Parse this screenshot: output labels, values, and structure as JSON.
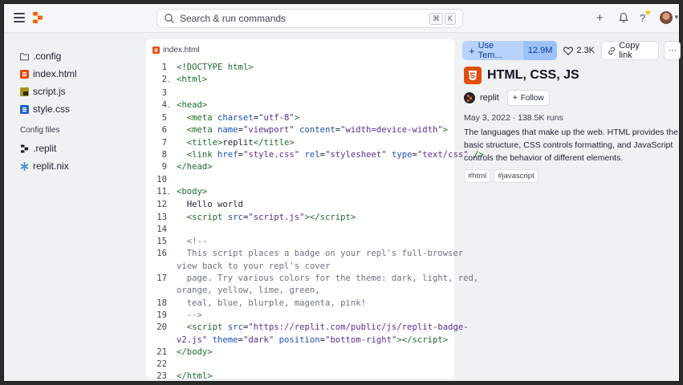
{
  "search": {
    "placeholder": "Search & run commands",
    "shortcut": [
      "⌘",
      "K"
    ]
  },
  "topbar": {
    "add_icon": "plus-icon",
    "notifications_icon": "bell-icon",
    "help_icon": "question-icon"
  },
  "sidebar": {
    "files": [
      {
        "name": ".config",
        "icon": "folder-icon"
      },
      {
        "name": "index.html",
        "icon": "html-file-icon"
      },
      {
        "name": "script.js",
        "icon": "js-file-icon"
      },
      {
        "name": "style.css",
        "icon": "css-file-icon"
      }
    ],
    "config_section_label": "Config files",
    "config_files": [
      {
        "name": ".replit",
        "icon": "replit-icon"
      },
      {
        "name": "replit.nix",
        "icon": "nix-icon"
      }
    ]
  },
  "editor": {
    "tab_name": "index.html",
    "lines": [
      {
        "n": "1",
        "fold": "",
        "html": "<span class=\"tag\">&lt;!DOCTYPE html&gt;</span>"
      },
      {
        "n": "2",
        "fold": "v",
        "html": "<span class=\"tag\">&lt;html&gt;</span>"
      },
      {
        "n": "3",
        "fold": "",
        "html": ""
      },
      {
        "n": "4",
        "fold": "v",
        "html": "<span class=\"tag\">&lt;head&gt;</span>"
      },
      {
        "n": "5",
        "fold": "",
        "html": "  <span class=\"tag\">&lt;meta</span> <span class=\"attr\">charset</span>=<span class=\"str\">\"utf-8\"</span><span class=\"tag\">&gt;</span>"
      },
      {
        "n": "6",
        "fold": "",
        "html": "  <span class=\"tag\">&lt;meta</span> <span class=\"attr\">name</span>=<span class=\"str\">\"viewport\"</span> <span class=\"attr\">content</span>=<span class=\"str\">\"width=device-width\"</span><span class=\"tag\">&gt;</span>"
      },
      {
        "n": "7",
        "fold": "",
        "html": "  <span class=\"tag\">&lt;title&gt;</span><span class=\"txt\">replit</span><span class=\"tag\">&lt;/title&gt;</span>"
      },
      {
        "n": "8",
        "fold": "",
        "html": "  <span class=\"tag\">&lt;link</span> <span class=\"attr\">href</span>=<span class=\"str\">\"style.css\"</span> <span class=\"attr\">rel</span>=<span class=\"str\">\"stylesheet\"</span> <span class=\"attr\">type</span>=<span class=\"str\">\"text/css\"</span> <span class=\"tag\">/&gt;</span>"
      },
      {
        "n": "9",
        "fold": "",
        "html": "<span class=\"tag\">&lt;/head&gt;</span>"
      },
      {
        "n": "10",
        "fold": "",
        "html": ""
      },
      {
        "n": "11",
        "fold": "v",
        "html": "<span class=\"tag\">&lt;body&gt;</span>"
      },
      {
        "n": "12",
        "fold": "",
        "html": "  <span class=\"txt\">Hello world</span>"
      },
      {
        "n": "13",
        "fold": "",
        "html": "  <span class=\"tag\">&lt;script</span> <span class=\"attr\">src</span>=<span class=\"str\">\"script.js\"</span><span class=\"tag\">&gt;&lt;/script&gt;</span>"
      },
      {
        "n": "14",
        "fold": "",
        "html": ""
      },
      {
        "n": "15",
        "fold": "",
        "html": "  <span class=\"cmt\">&lt;!--</span>"
      },
      {
        "n": "16",
        "fold": "",
        "html": "  <span class=\"cmt\">This script places a badge on your repl's full-browser</span>"
      },
      {
        "n": "",
        "fold": "",
        "html": "<span class=\"cmt\">view back to your repl's cover</span>"
      },
      {
        "n": "17",
        "fold": "",
        "html": "  <span class=\"cmt\">page. Try various colors for the theme: dark, light, red,</span>"
      },
      {
        "n": "",
        "fold": "",
        "html": "<span class=\"cmt\">orange, yellow, lime, green,</span>"
      },
      {
        "n": "18",
        "fold": "",
        "html": "  <span class=\"cmt\">teal, blue, blurple, magenta, pink!</span>"
      },
      {
        "n": "19",
        "fold": "",
        "html": "  <span class=\"cmt\">--&gt;</span>"
      },
      {
        "n": "20",
        "fold": "",
        "html": "  <span class=\"tag\">&lt;script</span> <span class=\"attr\">src</span>=<span class=\"str\">\"https://replit.com/public/js/replit-badge-</span>"
      },
      {
        "n": "",
        "fold": "",
        "html": "<span class=\"str\">v2.js\"</span> <span class=\"attr\">theme</span>=<span class=\"str\">\"dark\"</span> <span class=\"attr\">position</span>=<span class=\"str\">\"bottom-right\"</span><span class=\"tag\">&gt;&lt;/script&gt;</span>"
      },
      {
        "n": "21",
        "fold": "",
        "html": "<span class=\"tag\">&lt;/body&gt;</span>"
      },
      {
        "n": "22",
        "fold": "",
        "html": ""
      },
      {
        "n": "23",
        "fold": "",
        "html": "<span class=\"tag\">&lt;/html&gt;</span>"
      }
    ]
  },
  "panel": {
    "use_template_label": "Use Tem...",
    "forks_count": "12.9M",
    "likes_count": "2.3K",
    "copy_link_label": "Copy link",
    "more_label": "···",
    "title": "HTML, CSS, JS",
    "owner": "replit",
    "follow_label": "Follow",
    "meta": "May 3, 2022 · 138.5K runs",
    "description": "The languages that make up the web. HTML provides the basic structure, CSS controls formatting, and JavaScript controls the behavior of different elements.",
    "tags": [
      "#html",
      "#javascript"
    ]
  },
  "colors": {
    "accent": "#0b3f8f",
    "use_button_bg": "#b7d3fb",
    "html_badge": "#e24d10"
  }
}
